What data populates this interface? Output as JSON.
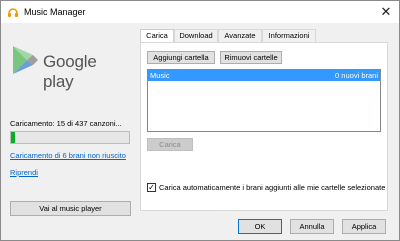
{
  "window": {
    "title": "Music Manager",
    "close_glyph": "✕"
  },
  "left": {
    "logo_text": "Google play",
    "status": "Caricamento: 15 di 437 canzoni...",
    "progress": 0.034,
    "link_failed": "Caricamento di 6 brani non riuscito",
    "link_retry": "Riprendi",
    "player_button": "Vai al music player"
  },
  "tabs": [
    {
      "label": "Carica",
      "active": true
    },
    {
      "label": "Download",
      "active": false
    },
    {
      "label": "Avanzate",
      "active": false
    },
    {
      "label": "Informazioni",
      "active": false
    }
  ],
  "upload": {
    "add_folder": "Aggiungi cartella",
    "remove_folders": "Rimuovi cartelle",
    "folders": [
      {
        "name": "Music",
        "count": "0 nuovi brani"
      }
    ],
    "upload_button": "Carica",
    "auto_upload_label": "Carica automaticamente i brani aggiunti alle mie cartelle selezionate",
    "auto_upload_checked": true
  },
  "footer": {
    "ok": "OK",
    "cancel": "Annulla",
    "apply": "Applica"
  },
  "colors": {
    "progress": "#06b025",
    "selection": "#3399ff",
    "link": "#0066cc"
  },
  "icons": {
    "app": "headphones-icon",
    "logo": "google-play-triangle-icon",
    "close": "close-icon",
    "check": "checkmark-icon"
  }
}
